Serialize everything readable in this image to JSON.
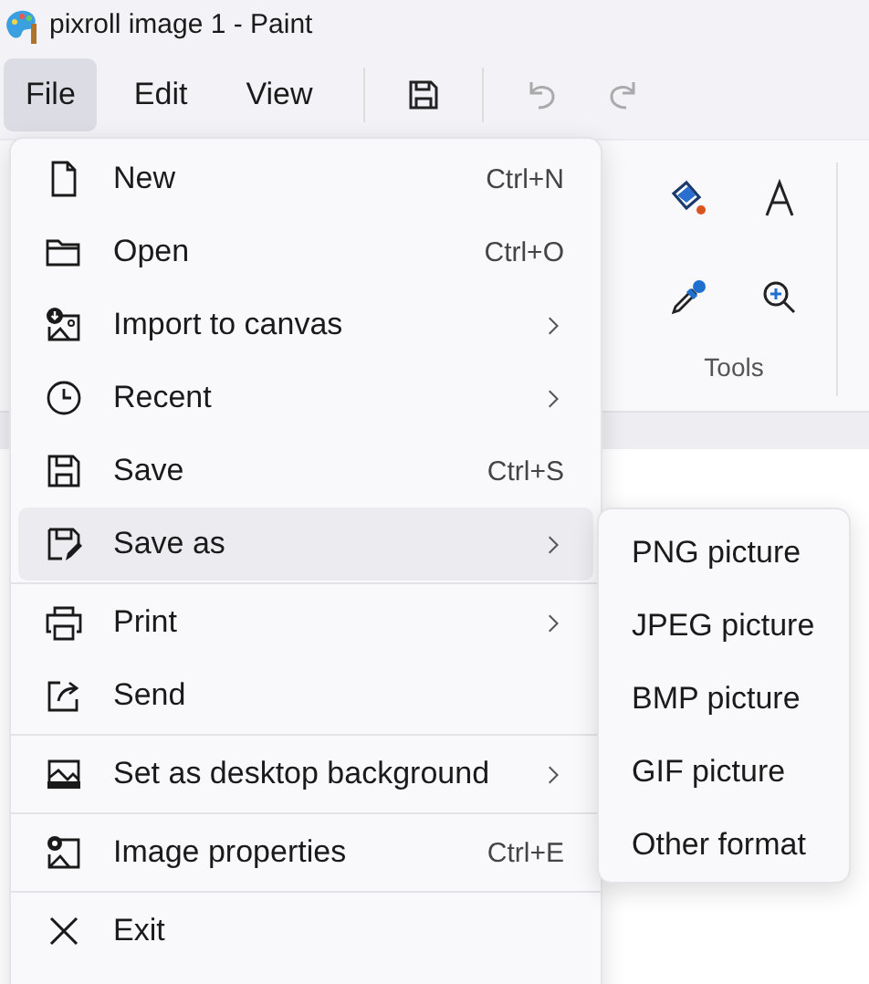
{
  "window": {
    "title": "pixroll image 1 - Paint"
  },
  "menu_bar": [
    {
      "label": "File",
      "selected": true
    },
    {
      "label": "Edit",
      "selected": false
    },
    {
      "label": "View",
      "selected": false
    }
  ],
  "ribbon": {
    "group_label": "Tools"
  },
  "file_menu": {
    "groups": [
      [
        {
          "label": "New",
          "shortcut": "Ctrl+N",
          "submenu": false,
          "selected": false
        },
        {
          "label": "Open",
          "shortcut": "Ctrl+O",
          "submenu": false,
          "selected": false
        },
        {
          "label": "Import to canvas",
          "submenu": true,
          "selected": false
        },
        {
          "label": "Recent",
          "submenu": true,
          "selected": false
        },
        {
          "label": "Save",
          "shortcut": "Ctrl+S",
          "submenu": false,
          "selected": false
        },
        {
          "label": "Save as",
          "submenu": true,
          "selected": true
        }
      ],
      [
        {
          "label": "Print",
          "submenu": true,
          "selected": false
        },
        {
          "label": "Send",
          "submenu": false,
          "selected": false
        }
      ],
      [
        {
          "label": "Set as desktop background",
          "submenu": true,
          "selected": false
        }
      ],
      [
        {
          "label": "Image properties",
          "shortcut": "Ctrl+E",
          "submenu": false,
          "selected": false
        }
      ],
      [
        {
          "label": "Exit",
          "submenu": false,
          "selected": false
        }
      ]
    ]
  },
  "save_as_menu": [
    "PNG picture",
    "JPEG picture",
    "BMP picture",
    "GIF picture",
    "Other format"
  ]
}
